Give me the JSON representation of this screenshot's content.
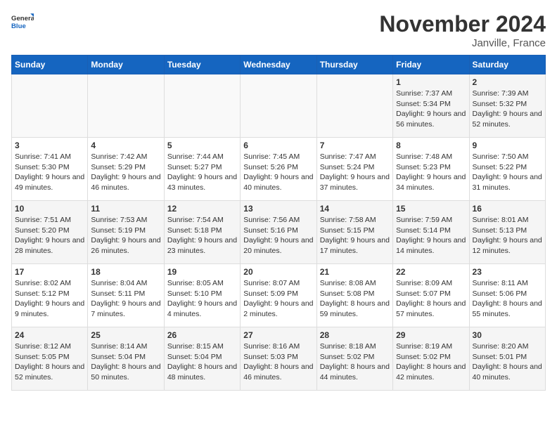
{
  "logo": {
    "line1": "General",
    "line2": "Blue"
  },
  "title": "November 2024",
  "location": "Janville, France",
  "headers": [
    "Sunday",
    "Monday",
    "Tuesday",
    "Wednesday",
    "Thursday",
    "Friday",
    "Saturday"
  ],
  "weeks": [
    [
      {
        "day": "",
        "info": ""
      },
      {
        "day": "",
        "info": ""
      },
      {
        "day": "",
        "info": ""
      },
      {
        "day": "",
        "info": ""
      },
      {
        "day": "",
        "info": ""
      },
      {
        "day": "1",
        "info": "Sunrise: 7:37 AM\nSunset: 5:34 PM\nDaylight: 9 hours and 56 minutes."
      },
      {
        "day": "2",
        "info": "Sunrise: 7:39 AM\nSunset: 5:32 PM\nDaylight: 9 hours and 52 minutes."
      }
    ],
    [
      {
        "day": "3",
        "info": "Sunrise: 7:41 AM\nSunset: 5:30 PM\nDaylight: 9 hours and 49 minutes."
      },
      {
        "day": "4",
        "info": "Sunrise: 7:42 AM\nSunset: 5:29 PM\nDaylight: 9 hours and 46 minutes."
      },
      {
        "day": "5",
        "info": "Sunrise: 7:44 AM\nSunset: 5:27 PM\nDaylight: 9 hours and 43 minutes."
      },
      {
        "day": "6",
        "info": "Sunrise: 7:45 AM\nSunset: 5:26 PM\nDaylight: 9 hours and 40 minutes."
      },
      {
        "day": "7",
        "info": "Sunrise: 7:47 AM\nSunset: 5:24 PM\nDaylight: 9 hours and 37 minutes."
      },
      {
        "day": "8",
        "info": "Sunrise: 7:48 AM\nSunset: 5:23 PM\nDaylight: 9 hours and 34 minutes."
      },
      {
        "day": "9",
        "info": "Sunrise: 7:50 AM\nSunset: 5:22 PM\nDaylight: 9 hours and 31 minutes."
      }
    ],
    [
      {
        "day": "10",
        "info": "Sunrise: 7:51 AM\nSunset: 5:20 PM\nDaylight: 9 hours and 28 minutes."
      },
      {
        "day": "11",
        "info": "Sunrise: 7:53 AM\nSunset: 5:19 PM\nDaylight: 9 hours and 26 minutes."
      },
      {
        "day": "12",
        "info": "Sunrise: 7:54 AM\nSunset: 5:18 PM\nDaylight: 9 hours and 23 minutes."
      },
      {
        "day": "13",
        "info": "Sunrise: 7:56 AM\nSunset: 5:16 PM\nDaylight: 9 hours and 20 minutes."
      },
      {
        "day": "14",
        "info": "Sunrise: 7:58 AM\nSunset: 5:15 PM\nDaylight: 9 hours and 17 minutes."
      },
      {
        "day": "15",
        "info": "Sunrise: 7:59 AM\nSunset: 5:14 PM\nDaylight: 9 hours and 14 minutes."
      },
      {
        "day": "16",
        "info": "Sunrise: 8:01 AM\nSunset: 5:13 PM\nDaylight: 9 hours and 12 minutes."
      }
    ],
    [
      {
        "day": "17",
        "info": "Sunrise: 8:02 AM\nSunset: 5:12 PM\nDaylight: 9 hours and 9 minutes."
      },
      {
        "day": "18",
        "info": "Sunrise: 8:04 AM\nSunset: 5:11 PM\nDaylight: 9 hours and 7 minutes."
      },
      {
        "day": "19",
        "info": "Sunrise: 8:05 AM\nSunset: 5:10 PM\nDaylight: 9 hours and 4 minutes."
      },
      {
        "day": "20",
        "info": "Sunrise: 8:07 AM\nSunset: 5:09 PM\nDaylight: 9 hours and 2 minutes."
      },
      {
        "day": "21",
        "info": "Sunrise: 8:08 AM\nSunset: 5:08 PM\nDaylight: 8 hours and 59 minutes."
      },
      {
        "day": "22",
        "info": "Sunrise: 8:09 AM\nSunset: 5:07 PM\nDaylight: 8 hours and 57 minutes."
      },
      {
        "day": "23",
        "info": "Sunrise: 8:11 AM\nSunset: 5:06 PM\nDaylight: 8 hours and 55 minutes."
      }
    ],
    [
      {
        "day": "24",
        "info": "Sunrise: 8:12 AM\nSunset: 5:05 PM\nDaylight: 8 hours and 52 minutes."
      },
      {
        "day": "25",
        "info": "Sunrise: 8:14 AM\nSunset: 5:04 PM\nDaylight: 8 hours and 50 minutes."
      },
      {
        "day": "26",
        "info": "Sunrise: 8:15 AM\nSunset: 5:04 PM\nDaylight: 8 hours and 48 minutes."
      },
      {
        "day": "27",
        "info": "Sunrise: 8:16 AM\nSunset: 5:03 PM\nDaylight: 8 hours and 46 minutes."
      },
      {
        "day": "28",
        "info": "Sunrise: 8:18 AM\nSunset: 5:02 PM\nDaylight: 8 hours and 44 minutes."
      },
      {
        "day": "29",
        "info": "Sunrise: 8:19 AM\nSunset: 5:02 PM\nDaylight: 8 hours and 42 minutes."
      },
      {
        "day": "30",
        "info": "Sunrise: 8:20 AM\nSunset: 5:01 PM\nDaylight: 8 hours and 40 minutes."
      }
    ]
  ]
}
